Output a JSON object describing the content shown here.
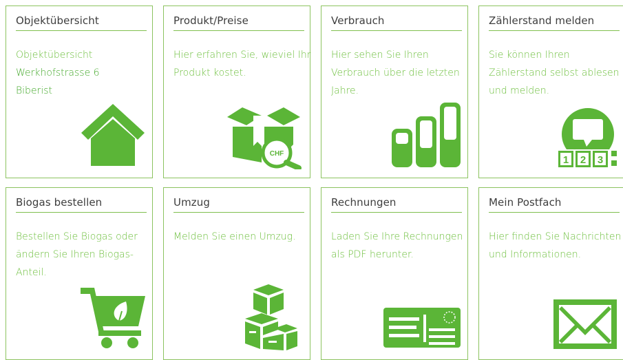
{
  "theme": {
    "accent": "#5bb537",
    "border": "#8cc35f",
    "title_text": "#3d3d3d",
    "desc_text": "#6cbf3c"
  },
  "tiles": [
    {
      "title": "Objektübersicht",
      "description": "Objektübersicht",
      "address_line1": "Werkhofstrasse 6",
      "address_line2": "Biberist",
      "icon": "house-icon"
    },
    {
      "title": "Produkt/Preise",
      "description": "Hier erfahren Sie, wieviel Ihr Produkt kostet.",
      "icon_label": "CHF",
      "icon": "box-price-search-icon"
    },
    {
      "title": "Verbrauch",
      "description": "Hier sehen Sie Ihren Verbrauch über die letzten Jahre.",
      "icon": "bar-levels-icon"
    },
    {
      "title": "Zählerstand melden",
      "description": "Sie können Ihren Zählerstand selbst ablesen und melden.",
      "icon_digits": [
        "1",
        "2",
        "3"
      ],
      "icon": "meter-reading-icon"
    },
    {
      "title": "Biogas bestellen",
      "description": "Bestellen Sie Biogas oder ändern Sie Ihren Biogas-Anteil.",
      "icon": "cart-leaf-icon"
    },
    {
      "title": "Umzug",
      "description": "Melden Sie einen Umzug.",
      "icon": "moving-boxes-icon"
    },
    {
      "title": "Rechnungen",
      "description": "Laden Sie Ihre Rechnungen als PDF herunter.",
      "icon": "invoice-card-icon"
    },
    {
      "title": "Mein Postfach",
      "description": "Hier finden Sie Nachrichten und Informationen.",
      "icon": "envelope-icon"
    }
  ]
}
